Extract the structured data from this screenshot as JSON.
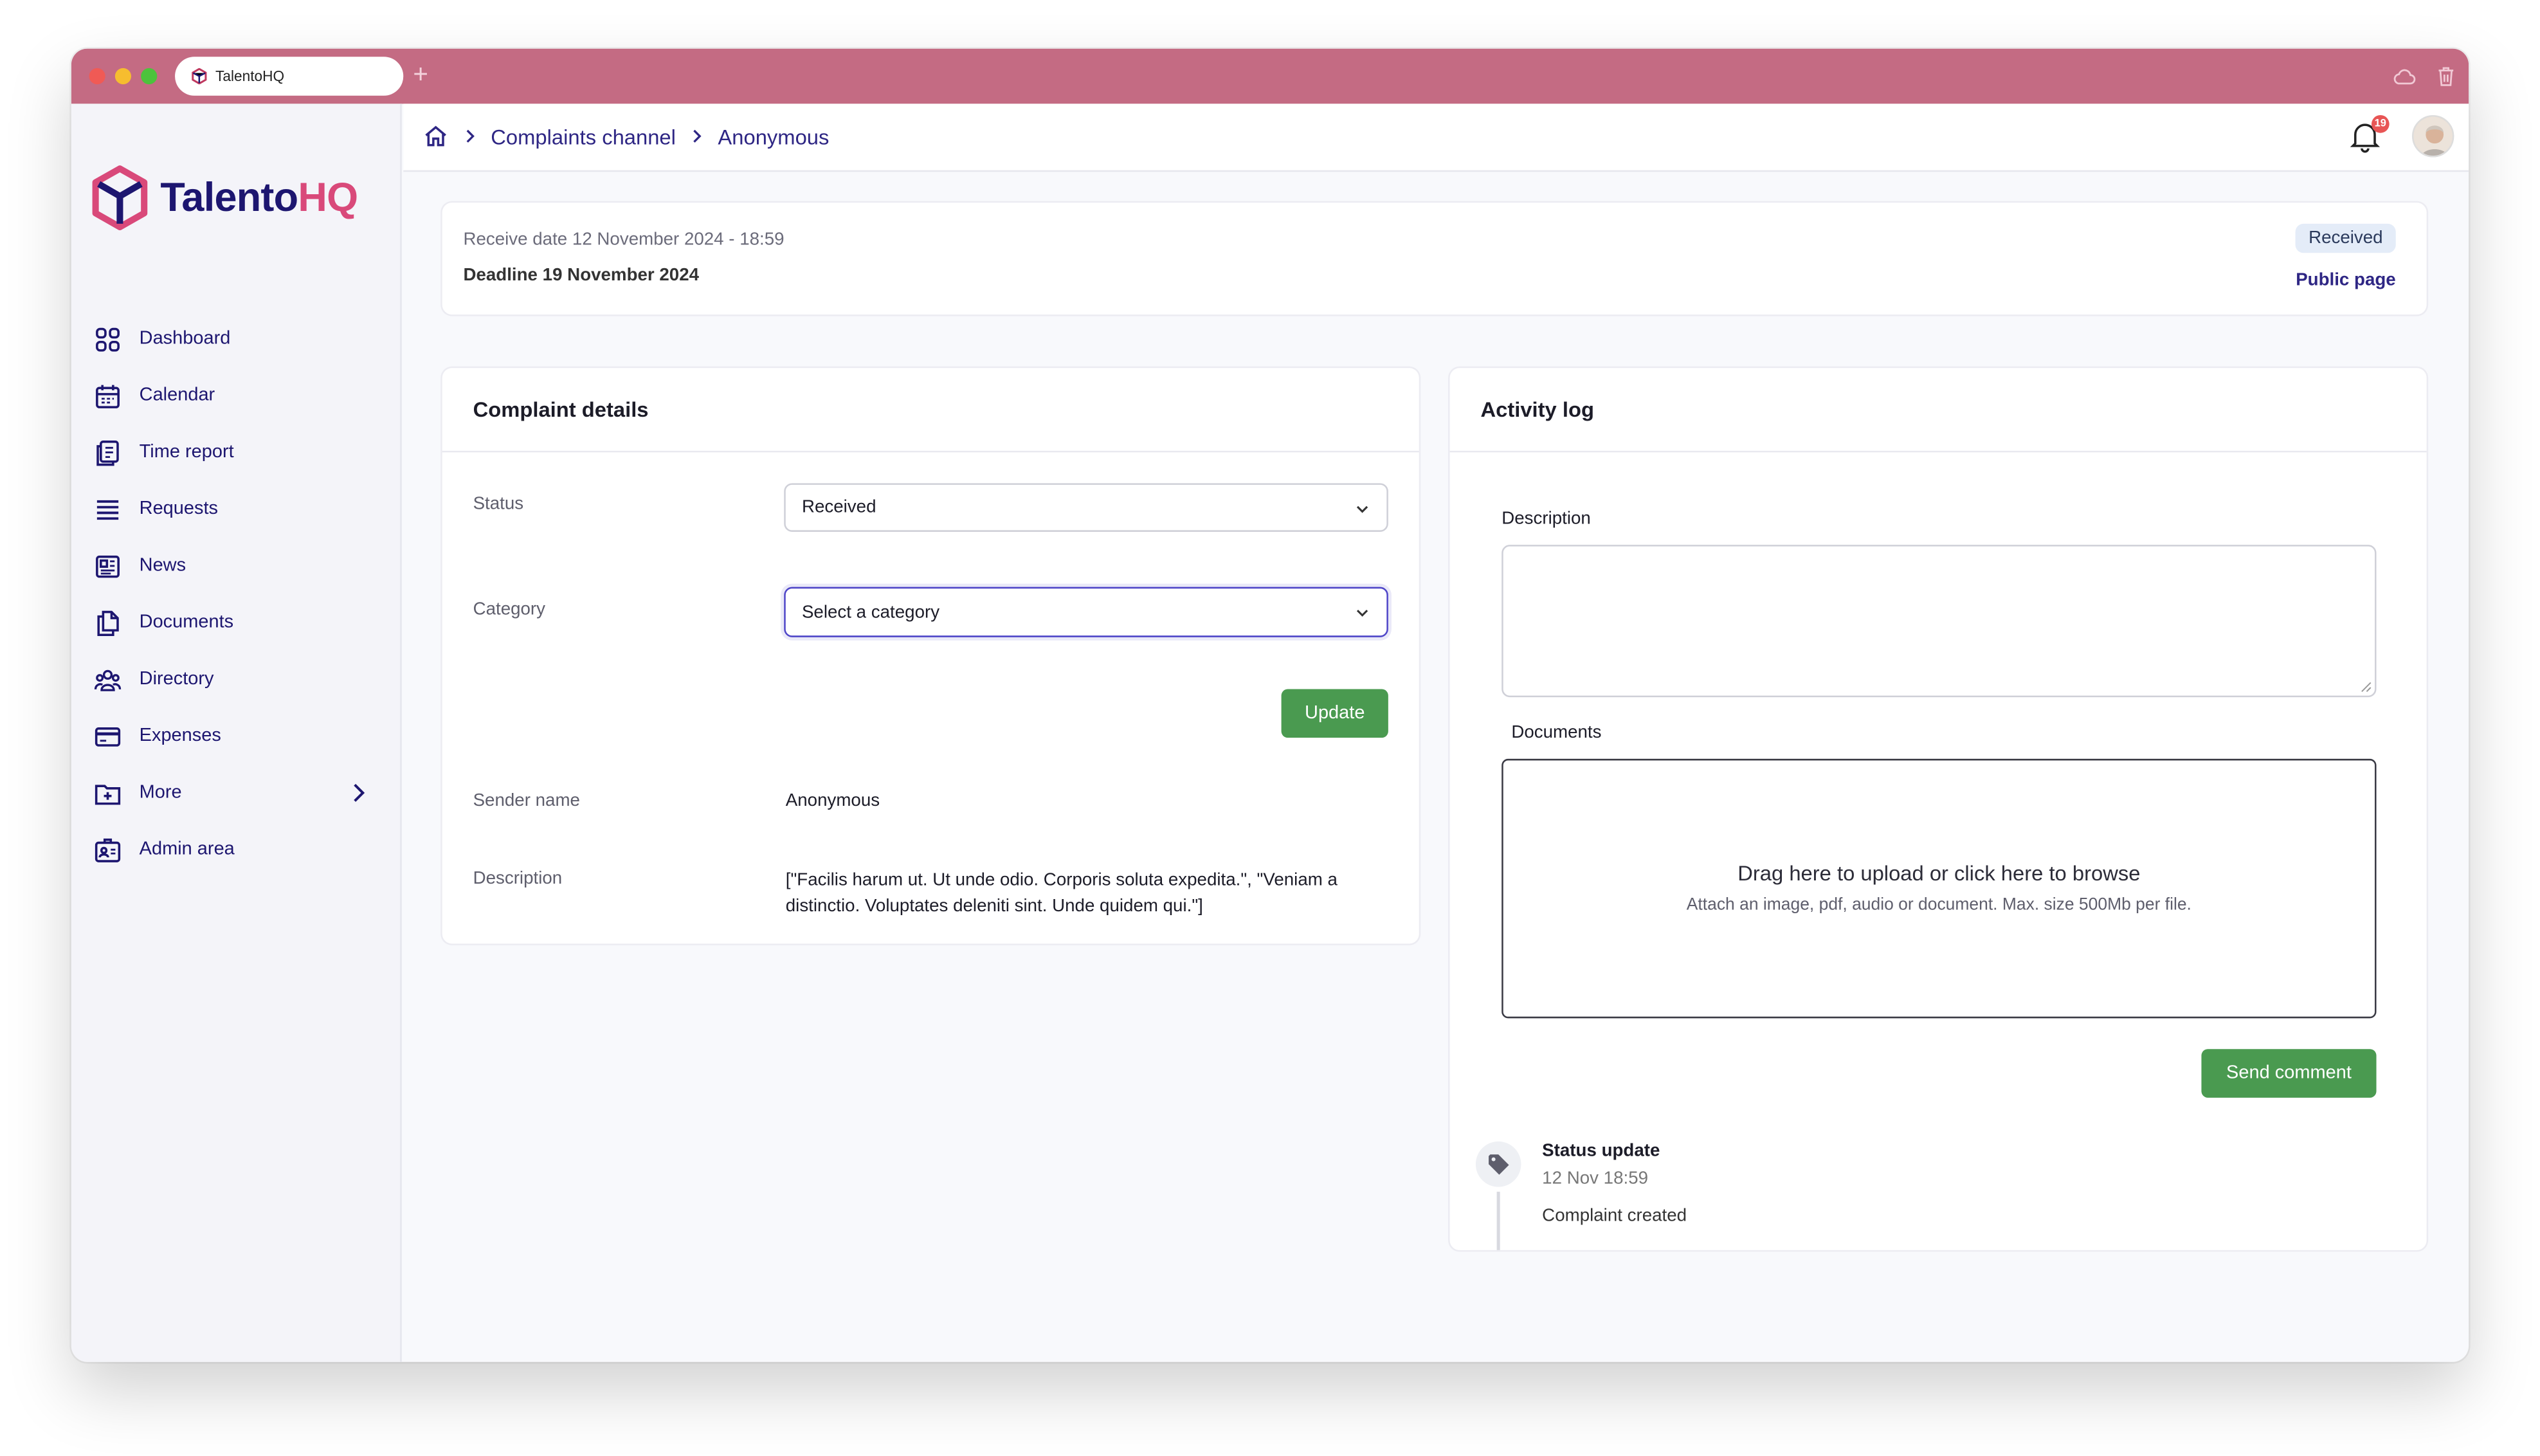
{
  "browser": {
    "tab_title": "TalentoHQ",
    "new_tab_symbol": "+"
  },
  "brand": {
    "name_part1": "Talento",
    "name_part2": "HQ",
    "primary_color": "#1d1670",
    "accent_color": "#d9497a",
    "titlebar_color": "#c46b83"
  },
  "sidebar": {
    "items": [
      {
        "label": "Dashboard",
        "icon": "dashboard-icon"
      },
      {
        "label": "Calendar",
        "icon": "calendar-icon"
      },
      {
        "label": "Time report",
        "icon": "time-report-icon"
      },
      {
        "label": "Requests",
        "icon": "requests-icon"
      },
      {
        "label": "News",
        "icon": "news-icon"
      },
      {
        "label": "Documents",
        "icon": "documents-icon"
      },
      {
        "label": "Directory",
        "icon": "directory-icon"
      },
      {
        "label": "Expenses",
        "icon": "expenses-icon"
      },
      {
        "label": "More",
        "icon": "more-icon"
      },
      {
        "label": "Admin area",
        "icon": "admin-area-icon"
      }
    ]
  },
  "header": {
    "breadcrumb": [
      "Complaints channel",
      "Anonymous"
    ],
    "notification_count": "19"
  },
  "complaint_info": {
    "receive_date": "Receive date 12 November 2024 - 18:59",
    "deadline": "Deadline 19 November 2024",
    "status_badge": "Received",
    "public_page_link": "Public page"
  },
  "details": {
    "title": "Complaint details",
    "status_label": "Status",
    "status_value": "Received",
    "category_label": "Category",
    "category_placeholder": "Select a category",
    "update_button": "Update",
    "sender_label": "Sender name",
    "sender_value": "Anonymous",
    "description_label": "Description",
    "description_value": "[\"Facilis harum ut. Ut unde odio. Corporis soluta expedita.\", \"Veniam a distinctio. Voluptates deleniti sint. Unde quidem qui.\"]"
  },
  "activity": {
    "title": "Activity log",
    "description_label": "Description",
    "documents_label": "Documents",
    "drop_title": "Drag here to upload or click here to browse",
    "drop_hint": "Attach an image, pdf, audio or document. Max. size 500Mb per file.",
    "send_button": "Send comment",
    "log": [
      {
        "title": "Status update",
        "time": "12 Nov 18:59",
        "text": "Complaint created"
      }
    ]
  }
}
